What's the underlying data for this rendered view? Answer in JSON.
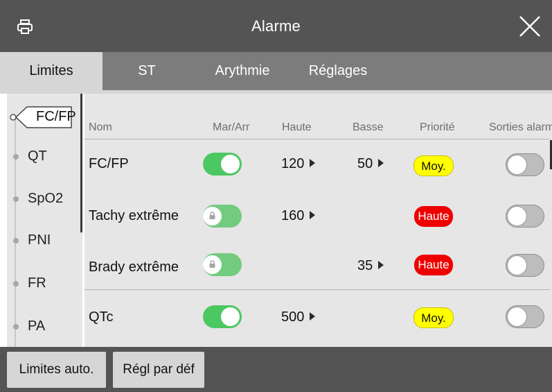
{
  "window": {
    "title": "Alarme",
    "print_icon": "printer-icon",
    "close_icon": "close-icon"
  },
  "tabs": [
    {
      "label": "Limites",
      "active": true
    },
    {
      "label": "ST",
      "active": false
    },
    {
      "label": "Arythmie",
      "active": false
    },
    {
      "label": "Réglages",
      "active": false
    }
  ],
  "sidenav": {
    "items": [
      {
        "label": "FC/FP",
        "selected": true
      },
      {
        "label": "QT",
        "selected": false
      },
      {
        "label": "SpO2",
        "selected": false
      },
      {
        "label": "PNI",
        "selected": false
      },
      {
        "label": "FR",
        "selected": false
      },
      {
        "label": "PA",
        "selected": false
      }
    ]
  },
  "table": {
    "headers": {
      "name": "Nom",
      "onoff": "Mar/Arr",
      "high": "Haute",
      "low": "Basse",
      "priority": "Priorité",
      "outputs": "Sorties alarme"
    },
    "rows": [
      {
        "name": "FC/FP",
        "onoff": "on",
        "locked": false,
        "high": "120",
        "low": "50",
        "priority": "Moy.",
        "priority_level": "medium",
        "outputs": "off"
      },
      {
        "name": "Tachy extrême",
        "onoff": "on",
        "locked": true,
        "high": "160",
        "low": "",
        "priority": "Haute",
        "priority_level": "high",
        "outputs": "off"
      },
      {
        "name": "Brady extrême",
        "onoff": "on",
        "locked": true,
        "high": "",
        "low": "35",
        "priority": "Haute",
        "priority_level": "high",
        "outputs": "off"
      },
      {
        "name": "QTc",
        "onoff": "on",
        "locked": false,
        "high": "500",
        "low": "",
        "priority": "Moy.",
        "priority_level": "medium",
        "outputs": "off"
      }
    ]
  },
  "footer": {
    "auto_limits": "Limites auto.",
    "default_settings": "Régl par déf"
  },
  "colors": {
    "titlebar": "#545454",
    "toggle_on": "#4cc862",
    "priority_medium": "#ffff00",
    "priority_high": "#ef0000"
  }
}
